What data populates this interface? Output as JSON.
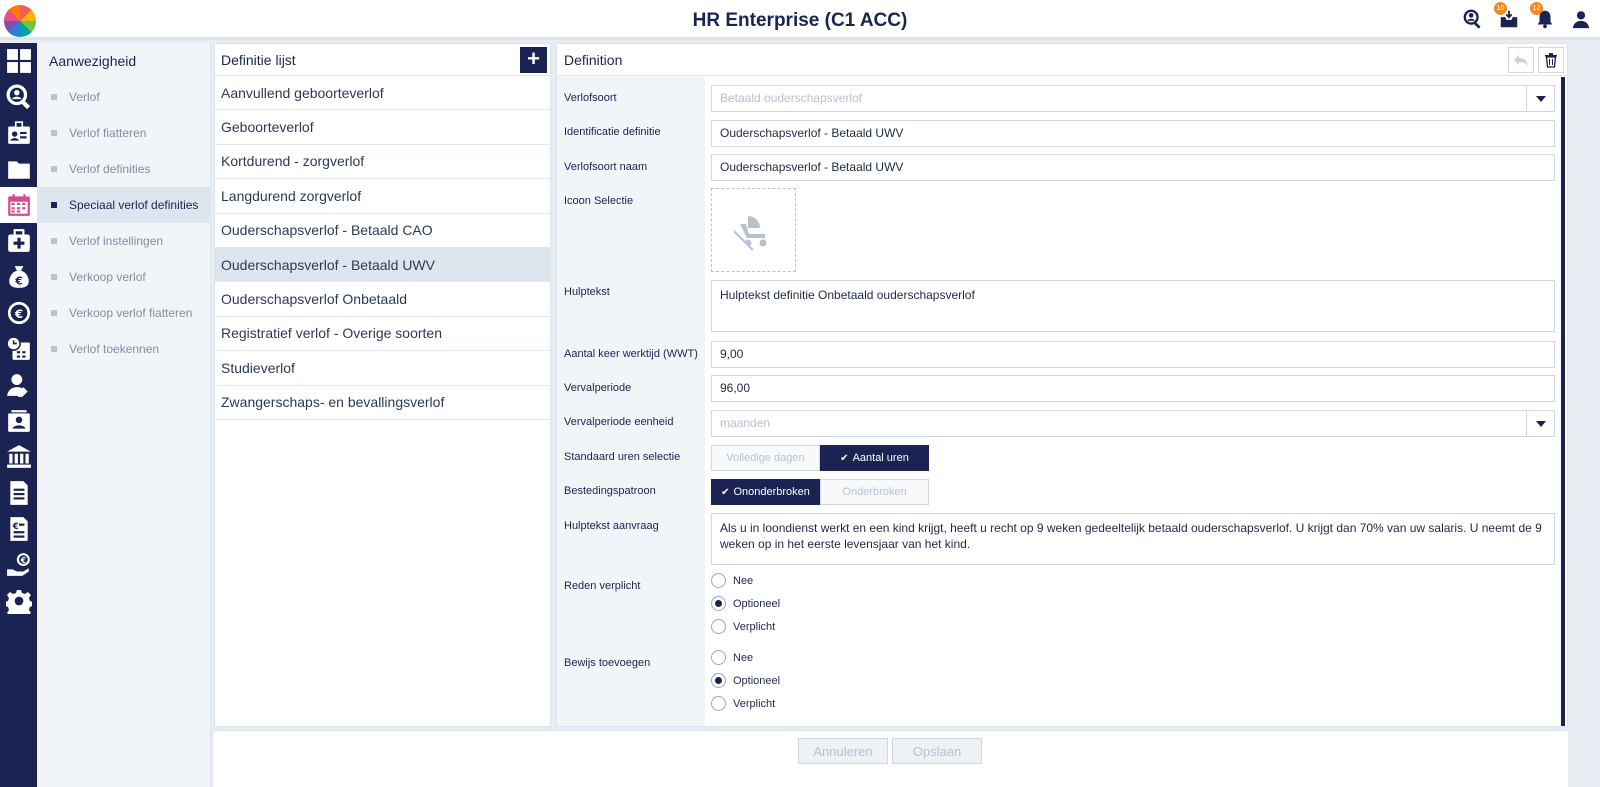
{
  "app": {
    "title": "HR Enterprise (C1 ACC)"
  },
  "header_icons": [
    {
      "name": "search-person-icon",
      "badge": ""
    },
    {
      "name": "inbox-icon",
      "badge": "10"
    },
    {
      "name": "bell-icon",
      "badge": "12"
    },
    {
      "name": "user-icon",
      "badge": ""
    }
  ],
  "submenu": {
    "title": "Aanwezigheid",
    "items": [
      {
        "label": "Verlof"
      },
      {
        "label": "Verlof fiatteren"
      },
      {
        "label": "Verlof definities"
      },
      {
        "label": "Speciaal verlof definities"
      },
      {
        "label": "Verlof instellingen"
      },
      {
        "label": "Verkoop verlof"
      },
      {
        "label": "Verkoop verlof fiatteren"
      },
      {
        "label": "Verlof toekennen"
      }
    ]
  },
  "list": {
    "title": "Definitie lijst",
    "add_label": "+",
    "items": [
      "Aanvullend geboorteverlof",
      "Geboorteverlof",
      "Kortdurend - zorgverlof",
      "Langdurend zorgverlof",
      "Ouderschapsverlof - Betaald CAO",
      "Ouderschapsverlof - Betaald UWV",
      "Ouderschapsverlof Onbetaald",
      "Registratief verlof - Overige soorten",
      "Studieverlof",
      "Zwangerschaps- en bevallingsverlof"
    ]
  },
  "definition": {
    "title": "Definition",
    "labels": {
      "verlofsoort": "Verlofsoort",
      "identificatie": "Identificatie definitie",
      "naam": "Verlofsoort naam",
      "icoon": "Icoon Selectie",
      "hulptekst": "Hulptekst",
      "aantal": "Aantal keer werktijd (WWT)",
      "vervalperiode": "Vervalperiode",
      "eenheid": "Vervalperiode eenheid",
      "standaard": "Standaard uren selectie",
      "besteding": "Bestedingspatroon",
      "hulptekst_aanvraag": "Hulptekst aanvraag",
      "reden": "Reden verplicht",
      "bewijs": "Bewijs toevoegen"
    },
    "values": {
      "verlofsoort": "Betaald ouderschapsverlof",
      "identificatie": "Ouderschapsverlof - Betaald UWV",
      "naam": "Ouderschapsverlof - Betaald UWV",
      "hulptekst": "Hulptekst definitie Onbetaald ouderschapsverlof",
      "aantal": "9,00",
      "vervalperiode": "96,00",
      "eenheid": "maanden",
      "hulptekst_aanvraag": "Als u in loondienst werkt en een kind krijgt, heeft u recht op 9 weken gedeeltelijk betaald ouderschapsverlof. U krijgt dan 70% van uw salaris. U neemt de 9 weken op in het eerste levensjaar van het kind."
    },
    "standaard_options": {
      "a": "Volledige dagen",
      "b": "Aantal uren"
    },
    "besteding_options": {
      "a": "Ononderbroken",
      "b": "Onderbroken"
    },
    "radio_options": {
      "nee": "Nee",
      "optioneel": "Optioneel",
      "verplicht": "Verplicht"
    }
  },
  "footer": {
    "cancel": "Annuleren",
    "save": "Opslaan"
  }
}
